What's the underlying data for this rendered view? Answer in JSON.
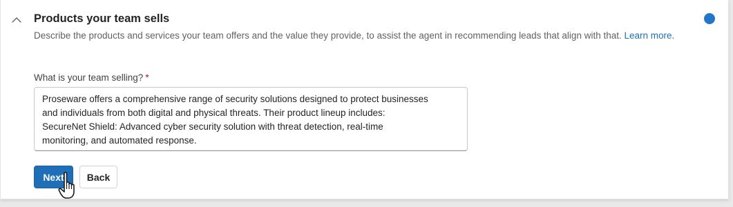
{
  "section": {
    "title": "Products your team sells",
    "description": "Describe the products and services your team offers and the value they provide, to assist the agent in recommending leads that align with that.",
    "learn_more": "Learn more.",
    "status_color": "#2276c9"
  },
  "field": {
    "label": "What is your team selling?",
    "required_marker": "*",
    "value_lines": [
      "Proseware offers a comprehensive range of security solutions designed to protect businesses",
      "and individuals from both digital and physical threats. Their product lineup includes:",
      "SecureNet Shield: Advanced cyber security solution with threat detection, real-time",
      "monitoring, and automated response."
    ]
  },
  "actions": {
    "next_label": "Next",
    "back_label": "Back"
  },
  "icons": {
    "collapse": "chevron-up-icon",
    "pointer": "hand-pointer-icon"
  }
}
